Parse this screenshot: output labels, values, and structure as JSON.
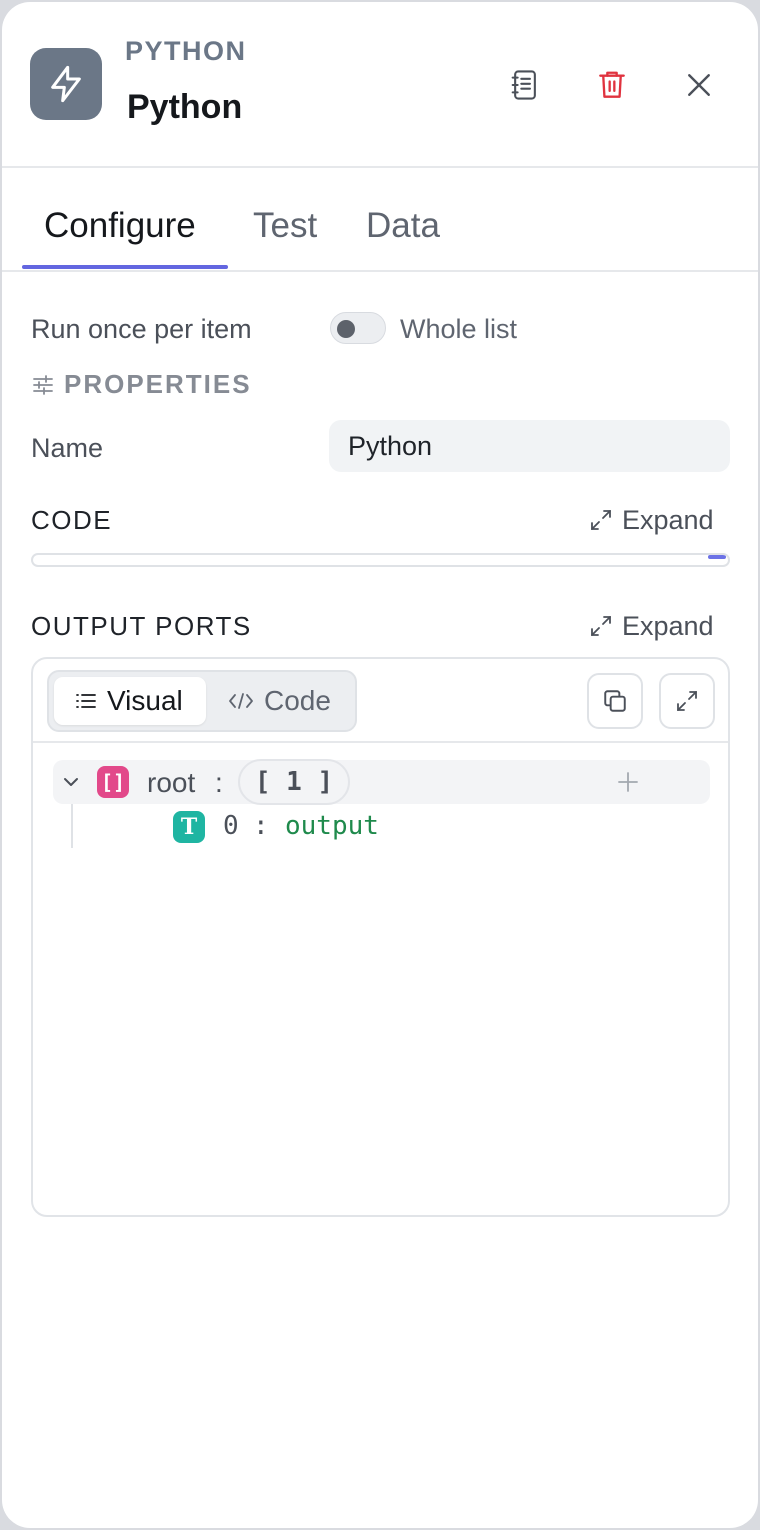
{
  "header": {
    "node_type": "PYTHON",
    "title": "Python",
    "icon": "lightning-icon",
    "actions": [
      "docs-icon",
      "trash-icon",
      "close-icon"
    ],
    "colors": {
      "icon_bg": "#6b7787",
      "delete": "#e0333f"
    }
  },
  "tabs": [
    {
      "label": "Configure",
      "active": true
    },
    {
      "label": "Test",
      "active": false
    },
    {
      "label": "Data",
      "active": false
    }
  ],
  "accent": "#6366e0",
  "run_mode": {
    "label": "Run once per item",
    "toggle_label": "Whole list",
    "toggle_on": false
  },
  "properties": {
    "title": "PROPERTIES",
    "name_label": "Name",
    "name_value": "Python"
  },
  "code": {
    "title": "CODE",
    "expand_label": "Expand"
  },
  "output_ports": {
    "title": "OUTPUT PORTS",
    "expand_label": "Expand",
    "modes": [
      {
        "label": "Visual",
        "icon": "list-icon",
        "active": true
      },
      {
        "label": "Code",
        "icon": "code-icon",
        "active": false
      }
    ],
    "tools": [
      "copy-icon",
      "fullscreen-icon"
    ],
    "tree": {
      "root": {
        "key": "root",
        "colon": ":",
        "count": "[ 1 ]",
        "type_glyph": "[]",
        "type_color": "#e2498a"
      },
      "items": [
        {
          "key": "0",
          "colon": ":",
          "value": "output",
          "type_glyph": "T",
          "type_color": "#1fb5a2"
        }
      ]
    }
  }
}
